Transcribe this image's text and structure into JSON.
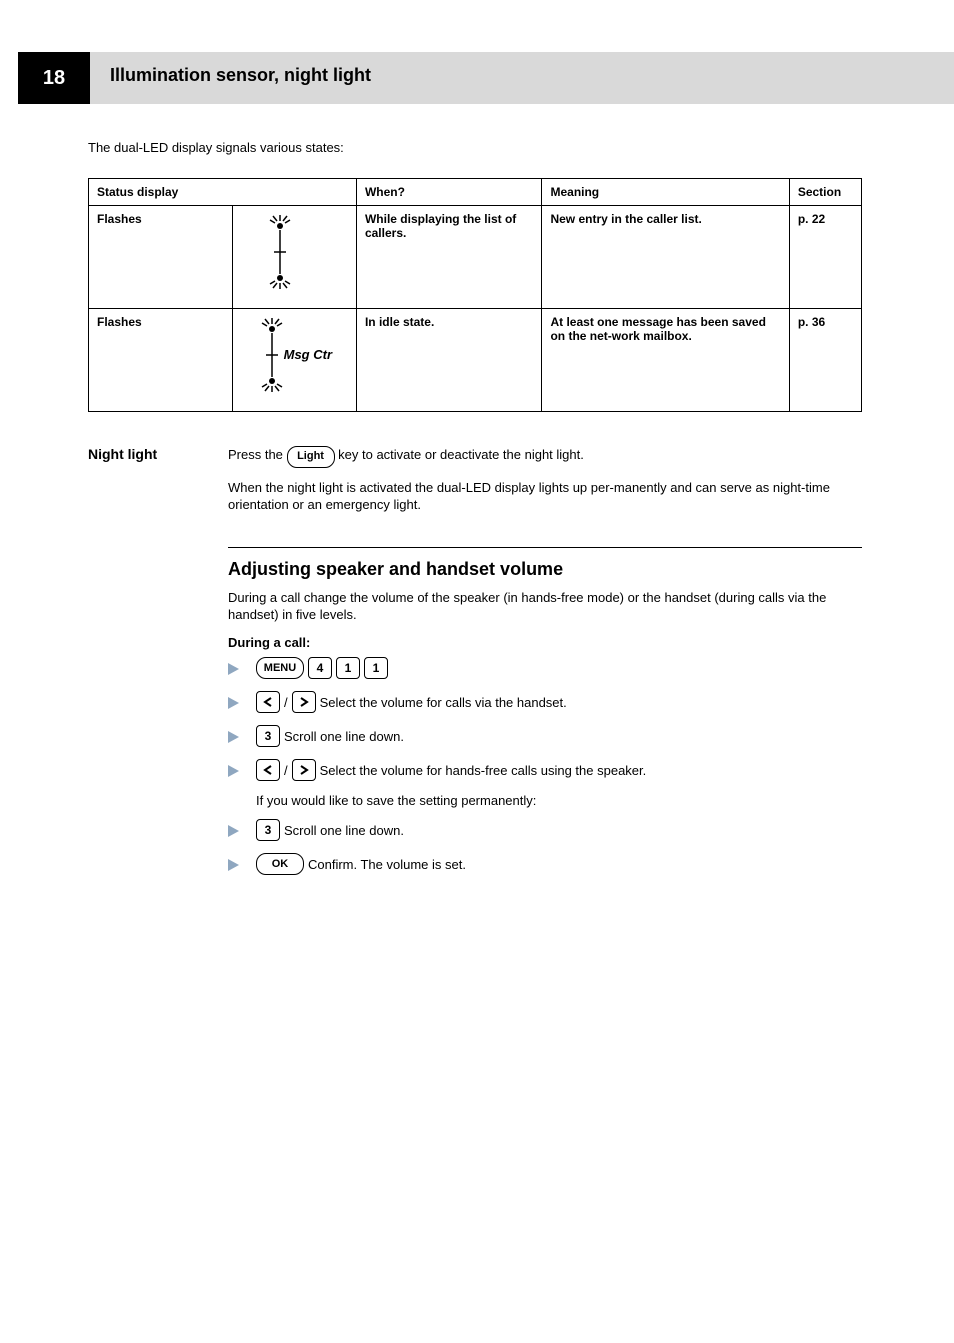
{
  "header": {
    "page_number": "18",
    "title": "Illumination sensor, night light"
  },
  "intro_line": "The dual-LED display signals various states:",
  "table": {
    "headers": [
      "Status display",
      "When?",
      "Meaning",
      "Section"
    ],
    "rows": [
      {
        "status_flash": "Flashes",
        "flash_label": "",
        "when": "While displaying the list of callers.",
        "meaning": "New entry in the caller list.",
        "section": "p. 22"
      },
      {
        "status_flash": "Flashes",
        "flash_label": "Msg Ctr",
        "when": "In idle state.",
        "meaning": "At least one message has been saved on the net-work mailbox.",
        "section": "p. 36"
      }
    ]
  },
  "night_light": {
    "label": "Night light",
    "para1_prefix": "Press the ",
    "key_label": "Light",
    "para1_suffix": " key to activate or deactivate the night light.",
    "para2": "When the night light is activated the dual-LED display lights up per-manently and can serve as night-time orientation or an emergency light."
  },
  "section": {
    "title": "Adjusting speaker and handset volume",
    "intro": "During a call change the volume of the speaker (in hands-free mode) or the handset (during calls via the handset) in five levels.",
    "sublabel": "During a call:",
    "steps": [
      {
        "keys": [
          "MENU_WIDE",
          "4",
          "1",
          "1"
        ],
        "text": ""
      },
      {
        "keys": [
          "LEFT",
          "RIGHT"
        ],
        "text": "Select the volume for calls via the handset."
      },
      {
        "keys": [
          "3"
        ],
        "text": "Scroll one line down."
      },
      {
        "keys": [
          "LEFT",
          "RIGHT"
        ],
        "text": "Select the volume for hands-free calls using the speaker."
      },
      {
        "text_only": "If you would like to save the setting permanently:"
      },
      {
        "keys": [
          "3"
        ],
        "text": "Scroll one line down."
      },
      {
        "keys": [
          "OK_WIDE"
        ],
        "text": "Confirm. The volume is set."
      }
    ],
    "keylabels": {
      "MENU": "MENU",
      "OK": "OK"
    }
  }
}
